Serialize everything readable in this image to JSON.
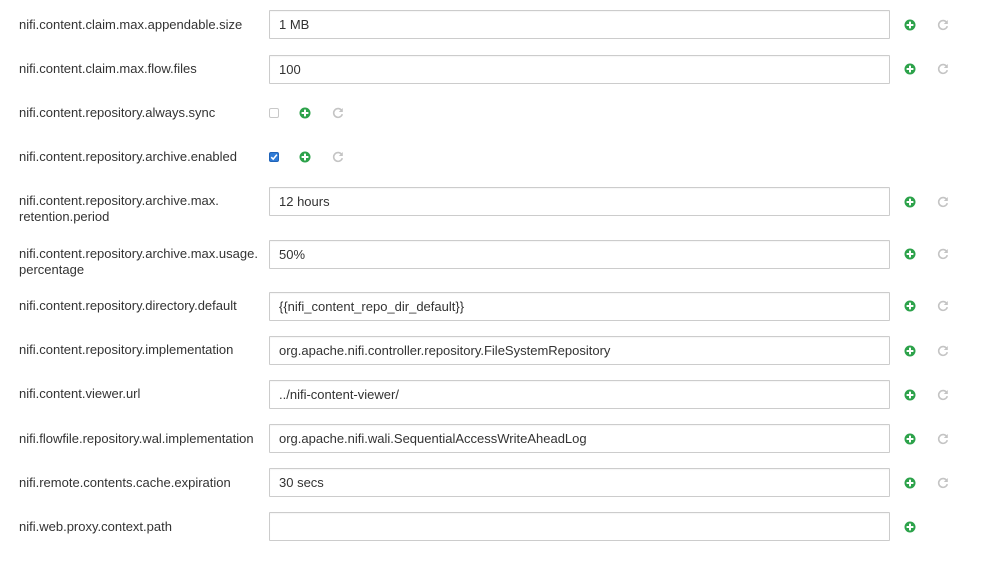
{
  "colors": {
    "add_green": "#2ca24a",
    "undo_gray": "#c4c4c4",
    "checkbox_blue": "#2f7bd6",
    "label_text": "#333333",
    "field_border": "#cccccc"
  },
  "icons": {
    "add": "plus-circle-icon",
    "revert": "undo-icon"
  },
  "properties": [
    {
      "key": "nifi.content.claim.max.appendable.size",
      "value": "1 MB"
    },
    {
      "key": "nifi.content.claim.max.flow.files",
      "value": "100"
    },
    {
      "key": "nifi.content.repository.always.sync",
      "checked": false
    },
    {
      "key": "nifi.content.repository.archive.enabled",
      "checked": true
    },
    {
      "key": "nifi.content.repository.archive.max.retention.period",
      "key_line1": "nifi.content.repository.archive.max.",
      "key_line2": "retention.period",
      "value": "12 hours"
    },
    {
      "key": "nifi.content.repository.archive.max.usage.percentage",
      "key_line1": "nifi.content.repository.archive.max.usage.",
      "key_line2": "percentage",
      "value": "50%"
    },
    {
      "key": "nifi.content.repository.directory.default",
      "value": "{{nifi_content_repo_dir_default}}"
    },
    {
      "key": "nifi.content.repository.implementation",
      "value": "org.apache.nifi.controller.repository.FileSystemRepository"
    },
    {
      "key": "nifi.content.viewer.url",
      "value": "../nifi-content-viewer/"
    },
    {
      "key": "nifi.flowfile.repository.wal.implementation",
      "value": "org.apache.nifi.wali.SequentialAccessWriteAheadLog"
    },
    {
      "key": "nifi.remote.contents.cache.expiration",
      "value": "30 secs"
    },
    {
      "key": "nifi.web.proxy.context.path",
      "value": ""
    }
  ]
}
